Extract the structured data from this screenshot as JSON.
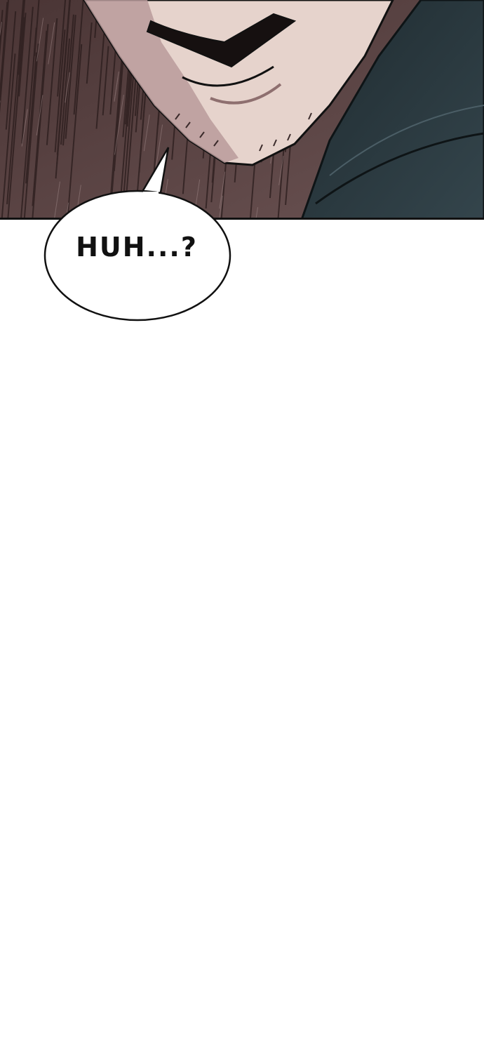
{
  "dialogue": {
    "text": "HUH...?"
  },
  "colors": {
    "rain_background": "#5b4444",
    "skin": "#e6d3cc",
    "skin_shadow": "#c3a8a8",
    "coat": "#26343a",
    "ink": "#111111",
    "bubble_fill": "#ffffff",
    "page_background": "#ffffff"
  }
}
